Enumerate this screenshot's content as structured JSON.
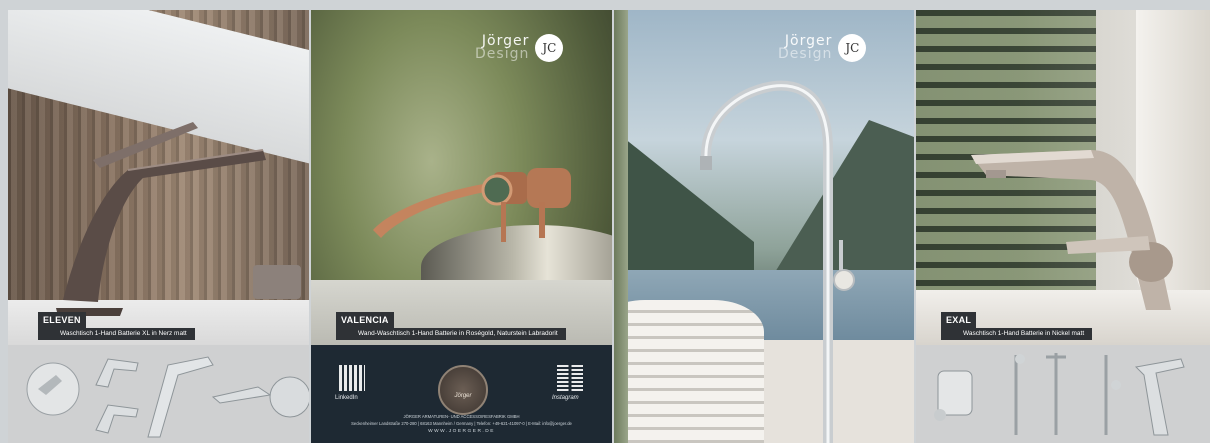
{
  "brand": {
    "line1": "Jörger",
    "line2": "Design",
    "monogram": "JC"
  },
  "products": [
    {
      "name": "ELEVEN",
      "desc": "Waschtisch 1-Hand Batterie XL in Nerz matt"
    },
    {
      "name": "VALENCIA",
      "desc": "Wand-Waschtisch 1-Hand Batterie in Roségold, Naturstein Labradorit"
    },
    {
      "name": "EXAL",
      "desc": "Waschtisch 1-Hand Batterie in Nickel matt"
    }
  ],
  "footer": {
    "linkedin": "LinkedIn",
    "seal_text": "Jörger",
    "instagram": "Instagram",
    "company": "JÖRGER ARMATUREN- UND ACCESSOIRESFABRIK GMBH",
    "address": "Seckenheimer Landstraße 270-280 | 68163 Mannheim / Germany | Telefon: +49-621-41097-0 | E-Mail: info@joerger.de",
    "website": "WWW.JOERGER.DE"
  },
  "colors": {
    "label_bg": "#2f3236",
    "footer_bg": "#1e2933",
    "rose_gold": "#c4845e",
    "chrome": "#d9dde0"
  }
}
